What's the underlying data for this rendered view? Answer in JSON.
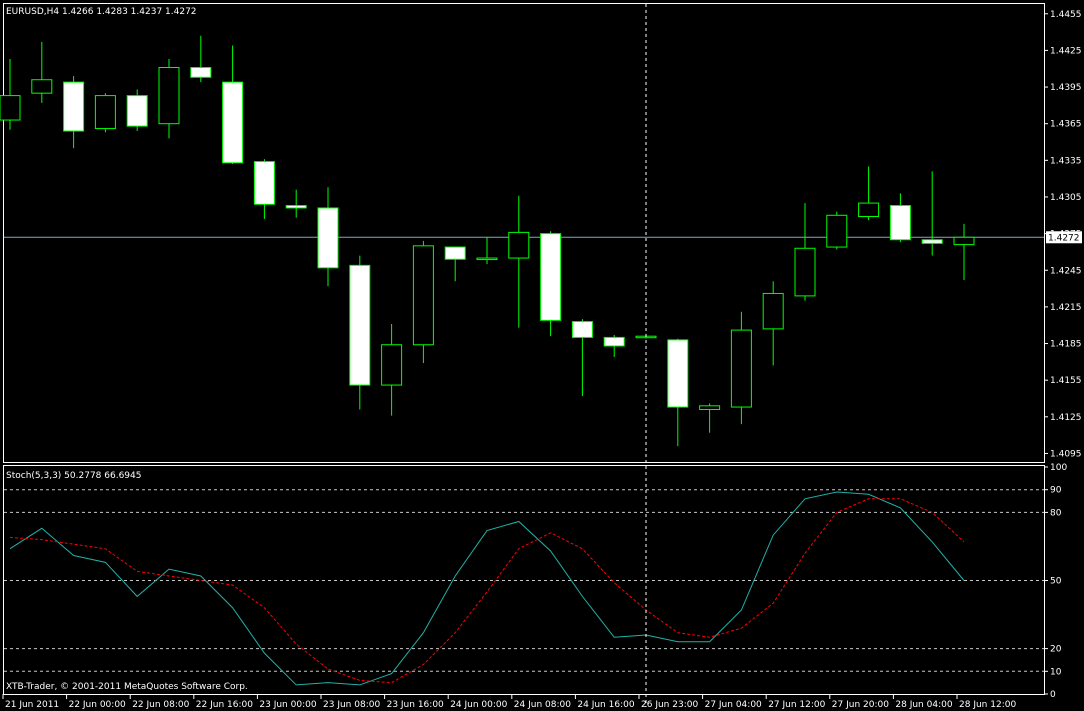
{
  "window": {
    "symbol_label": "EURUSD,H4  1.4266 1.4283 1.4237 1.4272"
  },
  "copyright": "XTB-Trader, © 2001-2011 MetaQuotes Software Corp.",
  "colors": {
    "background": "#000000",
    "bull_body": "#000000",
    "bear_body": "#ffffff",
    "wick": "#00ff00",
    "bid_line": "#7fa8c8",
    "axis": "#ffffff",
    "stoch_main": "#20b2aa",
    "stoch_signal": "#ff0000",
    "level_line": "#c8c8c8",
    "crosshair": "#ffffff"
  },
  "chart_data": [
    {
      "type": "candlestick",
      "symbol": "EURUSD",
      "timeframe": "H4",
      "current_price": "1.4272",
      "ylim": [
        1.4088,
        1.4463
      ],
      "y_ticks": [
        "1.4455",
        "1.4425",
        "1.4395",
        "1.4365",
        "1.4335",
        "1.4305",
        "1.4275",
        "1.4245",
        "1.4215",
        "1.4185",
        "1.4155",
        "1.4125",
        "1.4095"
      ],
      "y_tick_values": [
        1.4455,
        1.4425,
        1.4395,
        1.4365,
        1.4335,
        1.4305,
        1.4275,
        1.4245,
        1.4215,
        1.4185,
        1.4155,
        1.4125,
        1.4095
      ],
      "crosshair_bar": 20,
      "candles": [
        {
          "o": 1.4368,
          "h": 1.4418,
          "l": 1.436,
          "c": 1.4388
        },
        {
          "o": 1.439,
          "h": 1.4432,
          "l": 1.4382,
          "c": 1.4401
        },
        {
          "o": 1.4399,
          "h": 1.4404,
          "l": 1.4345,
          "c": 1.4359
        },
        {
          "o": 1.4361,
          "h": 1.439,
          "l": 1.4358,
          "c": 1.4388
        },
        {
          "o": 1.4388,
          "h": 1.4393,
          "l": 1.4359,
          "c": 1.4363
        },
        {
          "o": 1.4365,
          "h": 1.4418,
          "l": 1.4353,
          "c": 1.4411
        },
        {
          "o": 1.4411,
          "h": 1.4437,
          "l": 1.4399,
          "c": 1.4403
        },
        {
          "o": 1.4399,
          "h": 1.4429,
          "l": 1.4332,
          "c": 1.4333
        },
        {
          "o": 1.4334,
          "h": 1.4336,
          "l": 1.4287,
          "c": 1.4299
        },
        {
          "o": 1.4298,
          "h": 1.4311,
          "l": 1.4288,
          "c": 1.4296
        },
        {
          "o": 1.4296,
          "h": 1.4313,
          "l": 1.4232,
          "c": 1.4247
        },
        {
          "o": 1.4249,
          "h": 1.4257,
          "l": 1.4131,
          "c": 1.4151
        },
        {
          "o": 1.4151,
          "h": 1.4201,
          "l": 1.4126,
          "c": 1.4184
        },
        {
          "o": 1.4184,
          "h": 1.4269,
          "l": 1.4169,
          "c": 1.4265
        },
        {
          "o": 1.4264,
          "h": 1.4264,
          "l": 1.4236,
          "c": 1.4254
        },
        {
          "o": 1.4255,
          "h": 1.4272,
          "l": 1.425,
          "c": 1.4255
        },
        {
          "o": 1.4255,
          "h": 1.4306,
          "l": 1.4198,
          "c": 1.4276
        },
        {
          "o": 1.4275,
          "h": 1.4277,
          "l": 1.4191,
          "c": 1.4204
        },
        {
          "o": 1.4203,
          "h": 1.4205,
          "l": 1.4142,
          "c": 1.419
        },
        {
          "o": 1.419,
          "h": 1.4192,
          "l": 1.4174,
          "c": 1.4183
        },
        {
          "o": 1.4191,
          "h": 1.4193,
          "l": 1.4189,
          "c": 1.4191
        },
        {
          "o": 1.4188,
          "h": 1.4189,
          "l": 1.4101,
          "c": 1.4133
        },
        {
          "o": 1.4131,
          "h": 1.4136,
          "l": 1.4112,
          "c": 1.4134
        },
        {
          "o": 1.4133,
          "h": 1.4211,
          "l": 1.4119,
          "c": 1.4196
        },
        {
          "o": 1.4197,
          "h": 1.4236,
          "l": 1.4167,
          "c": 1.4226
        },
        {
          "o": 1.4224,
          "h": 1.43,
          "l": 1.422,
          "c": 1.4263
        },
        {
          "o": 1.4264,
          "h": 1.4293,
          "l": 1.4262,
          "c": 1.429
        },
        {
          "o": 1.4289,
          "h": 1.433,
          "l": 1.4286,
          "c": 1.43
        },
        {
          "o": 1.4298,
          "h": 1.4308,
          "l": 1.4268,
          "c": 1.427
        },
        {
          "o": 1.427,
          "h": 1.4326,
          "l": 1.4257,
          "c": 1.4267
        },
        {
          "o": 1.4266,
          "h": 1.4283,
          "l": 1.4237,
          "c": 1.4272
        }
      ]
    },
    {
      "type": "line",
      "indicator": "Stoch(5,3,3)",
      "label": "Stoch(5,3,3) 50.2778 66.6945",
      "ylim": [
        0,
        100
      ],
      "y_ticks": [
        "100",
        "90",
        "80",
        "50",
        "20",
        "10",
        "0"
      ],
      "y_tick_values": [
        100,
        90,
        80,
        50,
        20,
        10,
        0
      ],
      "levels": [
        90,
        80,
        50,
        20,
        10
      ],
      "series": [
        {
          "values": [
            64,
            73,
            61,
            58,
            43,
            55,
            52,
            38,
            18,
            4,
            5,
            4,
            9,
            27,
            52,
            72,
            76,
            63,
            43,
            25,
            26,
            23,
            23,
            37,
            70,
            86,
            89,
            88,
            82,
            67,
            50
          ]
        },
        {
          "values": [
            69,
            68,
            66,
            64,
            54,
            52,
            50,
            48,
            38,
            22,
            11,
            6,
            5,
            13,
            27,
            45,
            64,
            71,
            64,
            49,
            37,
            27,
            25,
            29,
            40,
            62,
            80,
            86,
            86,
            80,
            67
          ]
        }
      ],
      "x_labels": [
        "21 Jun 2011",
        "22 Jun 00:00",
        "22 Jun 08:00",
        "22 Jun 16:00",
        "23 Jun 00:00",
        "23 Jun 08:00",
        "23 Jun 16:00",
        "24 Jun 00:00",
        "24 Jun 08:00",
        "24 Jun 16:00",
        "26 Jun 23:00",
        "27 Jun 04:00",
        "27 Jun 12:00",
        "27 Jun 20:00",
        "28 Jun 04:00",
        "28 Jun 12:00"
      ],
      "x_label_bars": [
        0,
        2,
        4,
        6,
        8,
        10,
        12,
        14,
        16,
        18,
        20,
        22,
        24,
        26,
        28,
        30
      ]
    }
  ]
}
